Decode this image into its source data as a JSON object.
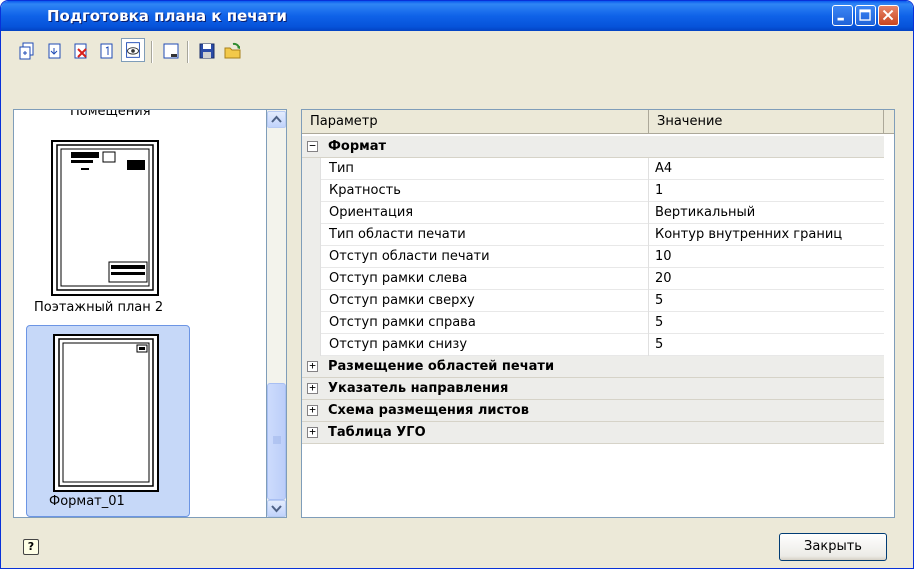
{
  "window": {
    "title": "Подготовка плана к печати"
  },
  "toolbar": {
    "icons": [
      "add-sheet-icon",
      "insert-sheet-icon",
      "delete-sheet-icon",
      "sheet-number-icon",
      "preview-icon",
      "frame-icon",
      "save-icon",
      "open-icon"
    ]
  },
  "thumbnails": {
    "items": [
      {
        "label": "Помещения"
      },
      {
        "label": "Поэтажный план 2"
      },
      {
        "label": "Формат_01",
        "selected": true
      }
    ]
  },
  "grid": {
    "headers": {
      "param": "Параметр",
      "value": "Значение"
    },
    "category_format": {
      "label": "Формат",
      "expanded": true,
      "toggle": "−"
    },
    "rows": [
      {
        "param": "Тип",
        "value": "А4"
      },
      {
        "param": "Кратность",
        "value": "1"
      },
      {
        "param": "Ориентация",
        "value": "Вертикальный"
      },
      {
        "param": "Тип области печати",
        "value": "Контур внутренних границ"
      },
      {
        "param": "Отступ области печати",
        "value": "10"
      },
      {
        "param": "Отступ рамки слева",
        "value": "20"
      },
      {
        "param": "Отступ рамки сверху",
        "value": "5"
      },
      {
        "param": "Отступ рамки справа",
        "value": "5"
      },
      {
        "param": "Отступ рамки снизу",
        "value": "5"
      }
    ],
    "collapsed_categories": [
      {
        "label": "Размещение областей печати",
        "toggle": "+"
      },
      {
        "label": "Указатель направления",
        "toggle": "+"
      },
      {
        "label": "Схема размещения листов",
        "toggle": "+"
      },
      {
        "label": "Таблица УГО",
        "toggle": "+"
      }
    ]
  },
  "footer": {
    "close_label": "Закрыть",
    "help_glyph": "?"
  },
  "colors": {
    "titlebar": "#0A5BEF",
    "selection": "#C6D8F8",
    "window_bg": "#ECE9D8"
  }
}
